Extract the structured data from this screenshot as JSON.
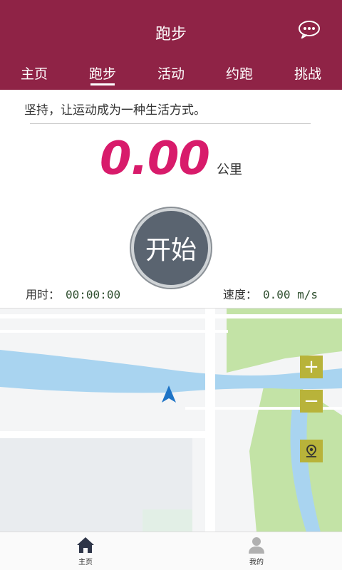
{
  "header": {
    "title": "跑步"
  },
  "tabs": [
    {
      "label": "主页"
    },
    {
      "label": "跑步"
    },
    {
      "label": "活动"
    },
    {
      "label": "约跑"
    },
    {
      "label": "挑战"
    }
  ],
  "slogan": "坚持，让运动成为一种生活方式。",
  "distance": {
    "value": "0.00",
    "unit": "公里"
  },
  "start_button": {
    "label": "开始"
  },
  "stats": {
    "time_label": "用时：",
    "time_value": "00:00:00",
    "speed_label": "速度：",
    "speed_value": "0.00 m/s"
  },
  "map": {
    "zoom_in": "+",
    "zoom_out": "−"
  },
  "bottom_nav": [
    {
      "label": "主页",
      "icon": "home-icon"
    },
    {
      "label": "我的",
      "icon": "user-icon"
    }
  ],
  "colors": {
    "header_bg": "#8f2346",
    "distance": "#d81b6b",
    "map_button": "#b8b33a",
    "river": "#a9d4f0",
    "park": "#c3e3a6"
  }
}
